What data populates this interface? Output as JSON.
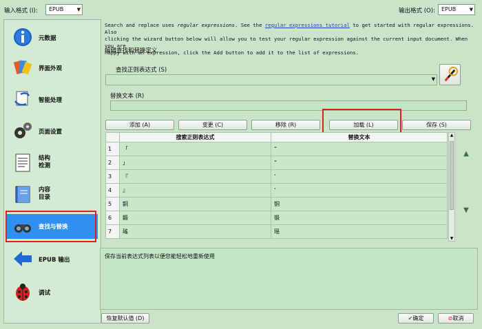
{
  "top": {
    "input_format_label": "输入格式 (I):",
    "input_format_value": "EPUB",
    "output_format_label": "输出格式 (O):",
    "output_format_value": "EPUB"
  },
  "sidebar": {
    "items": [
      {
        "label": "元数据",
        "icon": "info-icon"
      },
      {
        "label": "界面外观",
        "icon": "brush-icon"
      },
      {
        "label": "智能处理",
        "icon": "heuristics-icon"
      },
      {
        "label": "页面设置",
        "icon": "page-setup-icon"
      },
      {
        "label": "结构\n检测",
        "icon": "structure-icon"
      },
      {
        "label": "内容\n目录",
        "icon": "toc-icon"
      },
      {
        "label": "查找与替换",
        "icon": "binoculars-icon"
      },
      {
        "label": "EPUB 输出",
        "icon": "arrow-left-icon"
      },
      {
        "label": "调试",
        "icon": "ladybug-icon"
      }
    ],
    "active_index": 6
  },
  "description": {
    "line1_a": "Search and replace uses ",
    "line1_em": "regular expressions",
    "line1_b": ". See the ",
    "line1_link": "regular expressions tutorial",
    "line1_c": " to get started with regular expressions. Also",
    "line2": "clicking the wizard button below will allow you to test your regular expression against the current input document. When you are",
    "line3": "happy with an expression, click the Add button to add it to the list of expressions."
  },
  "group_title": "编辑查找和替换定义",
  "search": {
    "label": "查找正则表达式 (S)",
    "value": ""
  },
  "replace": {
    "label": "替换文本 (R)",
    "value": ""
  },
  "buttons": {
    "add": "添加 (A)",
    "change": "变更 (C)",
    "remove": "移除 (R)",
    "load": "加载 (L)",
    "save": "保存 (S)",
    "restore_defaults": "恢复默认值 (D)",
    "ok": "确定",
    "cancel": "取消"
  },
  "table": {
    "headers": [
      "",
      "搜索正则表达式",
      "替换文本"
    ],
    "rows": [
      {
        "n": "1",
        "search": "「",
        "replace": "“"
      },
      {
        "n": "2",
        "search": "」",
        "replace": "”"
      },
      {
        "n": "3",
        "search": "『",
        "replace": "‘"
      },
      {
        "n": "4",
        "search": "』",
        "replace": "’"
      },
      {
        "n": "5",
        "search": "銅",
        "replace": "铜"
      },
      {
        "n": "6",
        "search": "鍛",
        "replace": "锻"
      },
      {
        "n": "7",
        "search": "瑤",
        "replace": "瑶"
      }
    ]
  },
  "message": "保存当前表达式列表以便您能轻松地重新使用",
  "colors": {
    "active": "#2f8ff2",
    "highlight": "#e02020",
    "background": "#c9e4c9"
  }
}
